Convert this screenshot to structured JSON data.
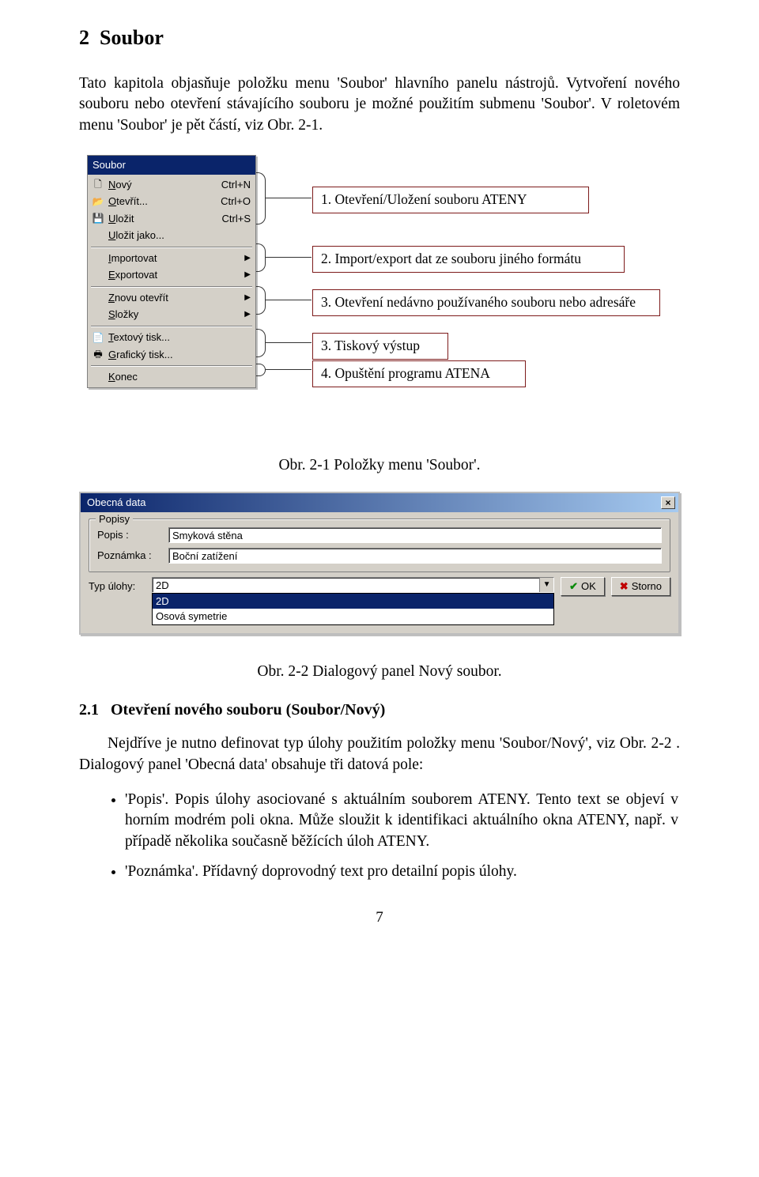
{
  "section_number": "2",
  "section_title": "Soubor",
  "intro_text": "Tato kapitola objasňuje položku menu 'Soubor' hlavního panelu nástrojů. Vytvoření nového souboru nebo otevření stávajícího souboru je možné použitím submenu 'Soubor'. V roletovém menu 'Soubor' je pět částí, viz Obr. 2-1.",
  "menu": {
    "title": "Soubor",
    "items": [
      {
        "icon": "🗋",
        "label": "Nový",
        "shortcut": "Ctrl+N",
        "submenu": false
      },
      {
        "icon": "📂",
        "label": "Otevřít...",
        "shortcut": "Ctrl+O",
        "submenu": false
      },
      {
        "icon": "💾",
        "label": "Uložit",
        "shortcut": "Ctrl+S",
        "submenu": false
      },
      {
        "icon": "",
        "label": "Uložit jako...",
        "shortcut": "",
        "submenu": false
      },
      {
        "sep": true
      },
      {
        "icon": "",
        "label": "Importovat",
        "shortcut": "",
        "submenu": true
      },
      {
        "icon": "",
        "label": "Exportovat",
        "shortcut": "",
        "submenu": true
      },
      {
        "sep": true
      },
      {
        "icon": "",
        "label": "Znovu otevřít",
        "shortcut": "",
        "submenu": true
      },
      {
        "icon": "",
        "label": "Složky",
        "shortcut": "",
        "submenu": true
      },
      {
        "sep": true
      },
      {
        "icon": "📄",
        "label": "Textový tisk...",
        "shortcut": "",
        "submenu": false
      },
      {
        "icon": "🖶",
        "label": "Grafický tisk...",
        "shortcut": "",
        "submenu": false
      },
      {
        "sep": true
      },
      {
        "icon": "",
        "label": "Konec",
        "shortcut": "",
        "submenu": false
      }
    ]
  },
  "callouts": {
    "c1": "1. Otevření/Uložení  souboru  ATENY",
    "c2": "2. Import/export dat ze souboru jiného formátu",
    "c3": "3. Otevření nedávno používaného souboru nebo adresáře",
    "c4": "3. Tiskový výstup",
    "c5": "4. Opuštění programu ATENA"
  },
  "fig1_caption": "Obr. 2-1 Položky menu 'Soubor'.",
  "dialog": {
    "title": "Obecná data",
    "group_label": "Popisy",
    "popis_label": "Popis :",
    "popis_value": "Smyková stěna",
    "poznamka_label": "Poznámka :",
    "poznamka_value": "Boční zatížení",
    "typ_label": "Typ úlohy:",
    "typ_value": "2D",
    "typ_options": [
      "2D",
      "Osová symetrie"
    ],
    "ok_label": "OK",
    "storno_label": "Storno"
  },
  "fig2_caption": "Obr. 2-2 Dialogový panel Nový soubor.",
  "subsection_number": "2.1",
  "subsection_title": "Otevření nového souboru (Soubor/Nový)",
  "para2": "Nejdříve je nutno definovat typ úlohy použitím položky menu 'Soubor/Nový', viz Obr. 2-2 . Dialogový panel 'Obecná data' obsahuje tři datová pole:",
  "bullets": [
    "'Popis'. Popis úlohy asociované s aktuálním souborem ATENY. Tento text se objeví v horním modrém poli okna. Může sloužit k identifikaci aktuálního okna ATENY, např. v případě několika současně běžících úloh ATENY.",
    "'Poznámka'. Přídavný doprovodný text pro detailní popis úlohy."
  ],
  "page_number": "7"
}
